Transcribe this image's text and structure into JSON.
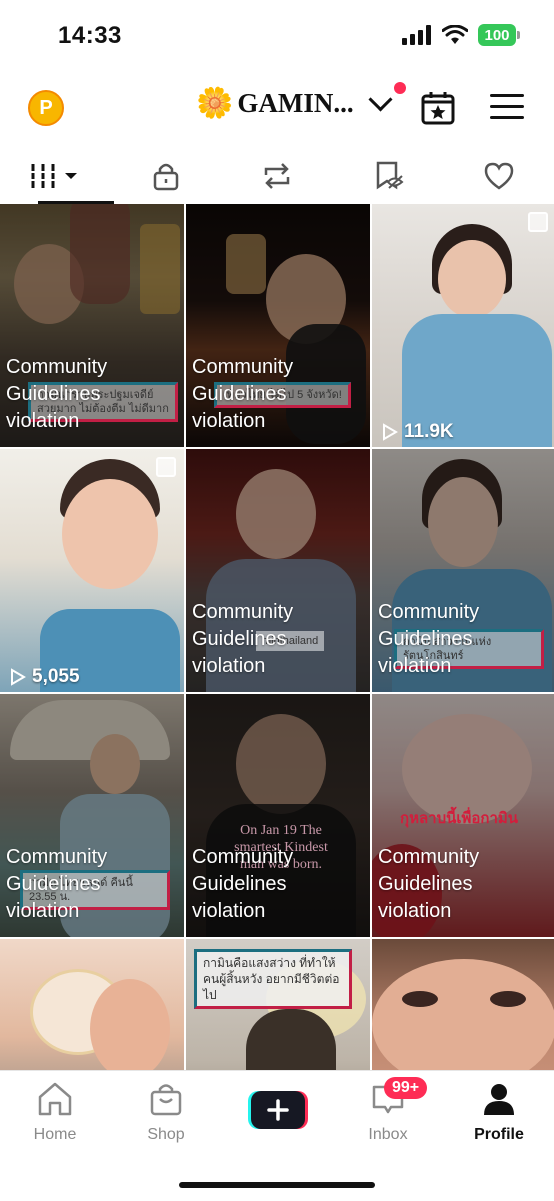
{
  "status_bar": {
    "time": "14:33",
    "battery": "100"
  },
  "header": {
    "coin_label": "P",
    "account_flower": "🌼",
    "account_name": "GAMIN..."
  },
  "tiles": [
    {
      "violation": true,
      "caption": "กามินกราบพระปฐมเจดีย์ สวยมาก ไม่ต้องตีม ไม่ดีมาก",
      "views": "",
      "multi": false
    },
    {
      "violation": true,
      "caption": "เที่ยวไทย ได้ไป 5 จังหวัด!",
      "views": "",
      "multi": false
    },
    {
      "violation": false,
      "caption": "",
      "views": "11.9K",
      "multi": true
    },
    {
      "violation": false,
      "caption": "",
      "views": "5,055",
      "multi": true
    },
    {
      "violation": true,
      "caption": "minthailand",
      "views": "",
      "multi": false
    },
    {
      "violation": true,
      "caption": "กามิน สาวงามแห่งรัตนโกสินทร์",
      "views": "",
      "multi": false
    },
    {
      "violation": true,
      "caption": "กามิน ไทยแลนด์ คืนนี้ 23.55 น.",
      "views": "",
      "multi": false
    },
    {
      "violation": true,
      "caption": "On Jan 19 The smartest Kindest man was born.",
      "views": "",
      "multi": false
    },
    {
      "violation": true,
      "caption": "กุหลาบนี้เพื่อกามิน",
      "views": "",
      "multi": false
    },
    {
      "violation": false,
      "caption": "",
      "views": "",
      "multi": false
    },
    {
      "violation": false,
      "caption": "กามินคือแสงสว่าง ที่ทำให้คนผู้สิ้นหวัง อยากมีชีวิตต่อไป",
      "views": "",
      "multi": false
    },
    {
      "violation": false,
      "caption": "",
      "views": "",
      "multi": false
    }
  ],
  "violation_label": [
    "Community",
    "Guidelines",
    "violation"
  ],
  "bottom_nav": {
    "home": "Home",
    "shop": "Shop",
    "inbox": "Inbox",
    "inbox_badge": "99+",
    "profile": "Profile"
  }
}
